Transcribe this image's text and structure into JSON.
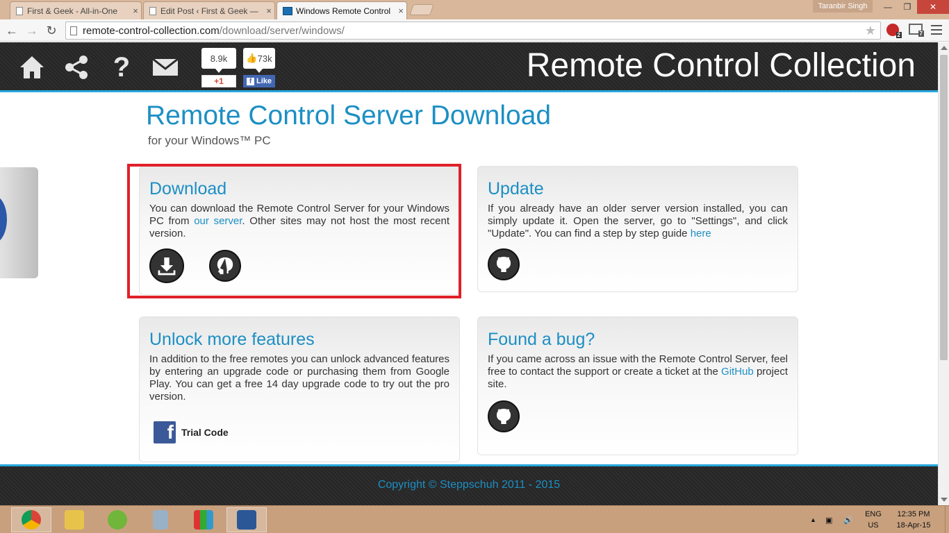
{
  "browser": {
    "tabs": [
      {
        "title": "First & Geek - All-in-One"
      },
      {
        "title": "Edit Post ‹ First & Geek —"
      },
      {
        "title": "Windows Remote Control"
      }
    ],
    "user": "Taranbir Singh",
    "url_host": "remote-control-collection.com",
    "url_path": "/download/server/windows/",
    "ext_badge_1": "2",
    "ext_badge_2": "7"
  },
  "site": {
    "title": "Remote Control Collection",
    "gplus_count": "8.9k",
    "gplus_label": "+1",
    "fb_count": "73k",
    "fb_like_label": "Like",
    "fb_like_f": "f"
  },
  "main": {
    "title": "Remote Control Server Download",
    "subtitle": "for your Windows™ PC",
    "cards": {
      "download": {
        "title": "Download",
        "text_1": "You can download the Remote Control Server for your Windows PC from ",
        "link": "our server",
        "text_2": ". Other sites may not host the most recent version."
      },
      "update": {
        "title": "Update",
        "text_1": "If you already have an older server version installed, you can simply update it. Open the server, go to \"Settings\", and click \"Update\". You can find a step by step guide ",
        "link": "here"
      },
      "unlock": {
        "title": "Unlock more features",
        "text": "In addition to the free remotes you can unlock advanced features by entering an upgrade code or purchasing them from Google Play. You can get a free 14 day upgrade code to try out the pro version.",
        "trial_label": "Trial Code",
        "fb_glyph": "f"
      },
      "bug": {
        "title": "Found a bug?",
        "text_1": "If you came across an issue with the Remote Control Server, feel free to contact the support or create a ticket at the ",
        "link": "GitHub",
        "text_2": " project site."
      }
    }
  },
  "footer": {
    "copyright": "Copyright © Steppschuh 2011 - 2015"
  },
  "taskbar": {
    "lang_1": "ENG",
    "lang_2": "US",
    "time": "12:35 PM",
    "date": "18-Apr-15"
  },
  "colors": {
    "accent": "#1c8fc4",
    "highlight": "#e0202a",
    "header_bg": "#2b2b2b"
  },
  "icons": [
    "home-icon",
    "share-icon",
    "help-icon",
    "mail-icon",
    "download-icon",
    "github-icon",
    "facebook-icon"
  ]
}
